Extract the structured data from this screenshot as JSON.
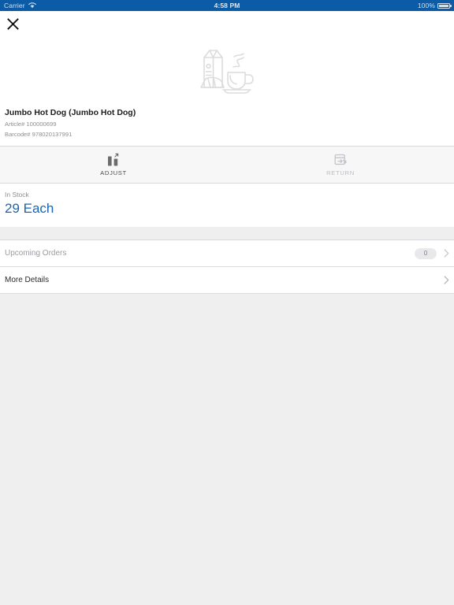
{
  "statusbar": {
    "carrier": "Carrier",
    "wifi_icon": "wifi-icon",
    "time": "4:58 PM",
    "battery_percent": "100%",
    "battery_icon": "battery-full-icon"
  },
  "navbar": {
    "close_icon": "close-icon"
  },
  "hero": {
    "placeholder_icon": "grocery-placeholder-icon"
  },
  "product": {
    "title": "Jumbo Hot Dog (Jumbo Hot Dog)",
    "article": "Article# 100000699",
    "barcode": "Barcode# 978020137991"
  },
  "tabs": [
    {
      "label": "ADJUST",
      "icon": "adjust-bars-icon",
      "active": true
    },
    {
      "label": "RETURN",
      "icon": "return-box-icon",
      "active": false
    }
  ],
  "stock": {
    "label": "In Stock",
    "value": "29 Each"
  },
  "rows": [
    {
      "label": "Upcoming Orders",
      "badge": "0",
      "chevron_icon": "chevron-right-icon"
    },
    {
      "label": "More Details",
      "badge": null,
      "chevron_icon": "chevron-right-icon"
    }
  ],
  "colors": {
    "status_bar": "#0b5ba6",
    "accent_blue": "#1665b3",
    "page_background": "#efeff0",
    "card_background": "#ffffff",
    "tab_background": "#f7f7f8",
    "muted_text": "#8e8e93",
    "badge_background": "#e9e9eb"
  }
}
